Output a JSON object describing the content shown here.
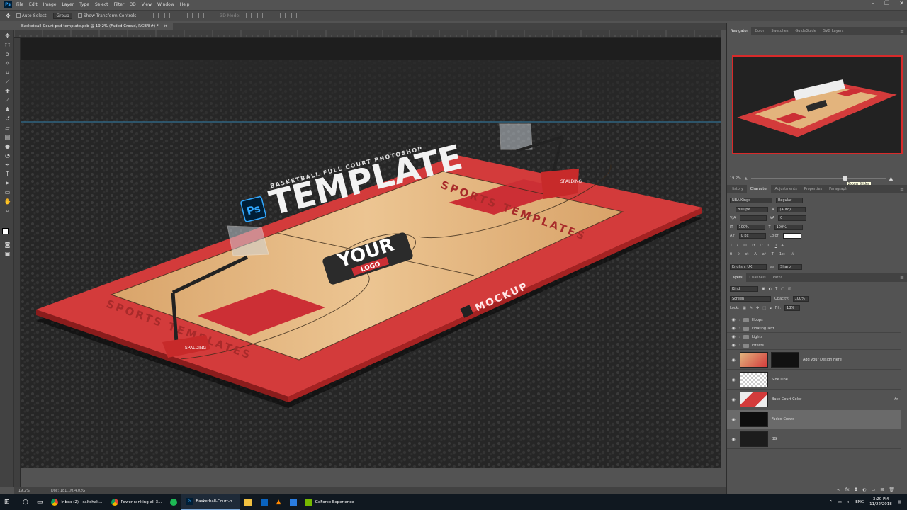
{
  "app": {
    "logo": "Ps",
    "menu": [
      "File",
      "Edit",
      "Image",
      "Layer",
      "Type",
      "Select",
      "Filter",
      "3D",
      "View",
      "Window",
      "Help"
    ],
    "window_controls": [
      "–",
      "❐",
      "✕"
    ]
  },
  "options_bar": {
    "auto_select_label": "Auto-Select:",
    "auto_select_value": "Group",
    "transform_label": "Show Transform Controls",
    "mode_3d": "3D Mode:"
  },
  "document": {
    "tab_title": "Basketball-Court-psd-template.psb @ 19.2% (Faded Crowd, RGB/8#) *",
    "close": "×"
  },
  "status": {
    "zoom": "19.2%",
    "doc": "Doc: 181.1M/4.02G"
  },
  "canvas_art": {
    "template_text": "TEMPLATE",
    "subtitle_text": "BASKETBALL FULL COURT PHOTOSHOP",
    "ps_badge": "Ps",
    "logo_your": "YOUR",
    "logo_logo": "LOGO",
    "sports_templates": "SPORTS TEMPLATES",
    "mockup": "MOCKUP",
    "brand": "SPALDING",
    "colors": {
      "court_red": "#d33b3b",
      "wood": "#e3b47d",
      "paint": "#cc2f35",
      "bg": "#282828"
    }
  },
  "navigator": {
    "tabs": [
      "Navigator",
      "Color",
      "Swatches",
      "GuideGuide",
      "SVG Layers"
    ],
    "zoom": "19.2%",
    "slider_tooltip": "Zoom Slider",
    "zoom_fraction": 0.7
  },
  "character": {
    "tabs": [
      "History",
      "Character",
      "Adjustments",
      "Properties",
      "Paragraph"
    ],
    "font_family": "NBA Kings",
    "font_style": "Regular",
    "font_size": "800 px",
    "leading": "(Auto)",
    "tracking": "0",
    "vscale": "100%",
    "hscale": "100%",
    "baseline": "0 px",
    "color_label": "Color:",
    "language": "English: UK",
    "antialias": "Sharp",
    "type_buttons": [
      "T",
      "T",
      "TT",
      "Tt",
      "T¹",
      "T₁",
      "T",
      "T̶"
    ]
  },
  "layers": {
    "tabs": [
      "Layers",
      "Channels",
      "Paths"
    ],
    "filter_kind": "Kind",
    "blend_mode": "Screen",
    "opacity_label": "Opacity:",
    "opacity": "100%",
    "lock_label": "Lock:",
    "fill_label": "Fill:",
    "fill": "13%",
    "groups": [
      "Hoops",
      "Floating Text",
      "Lights",
      "Effects"
    ],
    "items": [
      {
        "name": "Add your Design Here"
      },
      {
        "name": "Side Line"
      },
      {
        "name": "Base Court Color"
      },
      {
        "name": "Faded Crowd"
      },
      {
        "name": "BG"
      }
    ],
    "fx": "fx"
  },
  "taskbar": {
    "items": [
      {
        "label": "Inbox (2) - saltshak..."
      },
      {
        "label": "Power ranking all 3..."
      },
      {
        "label": "Basketball-Court-p..."
      },
      {
        "label": "GeForce Experience"
      }
    ],
    "tray_lang": "ENG",
    "time": "3:20 PM",
    "date": "11/22/2018"
  }
}
